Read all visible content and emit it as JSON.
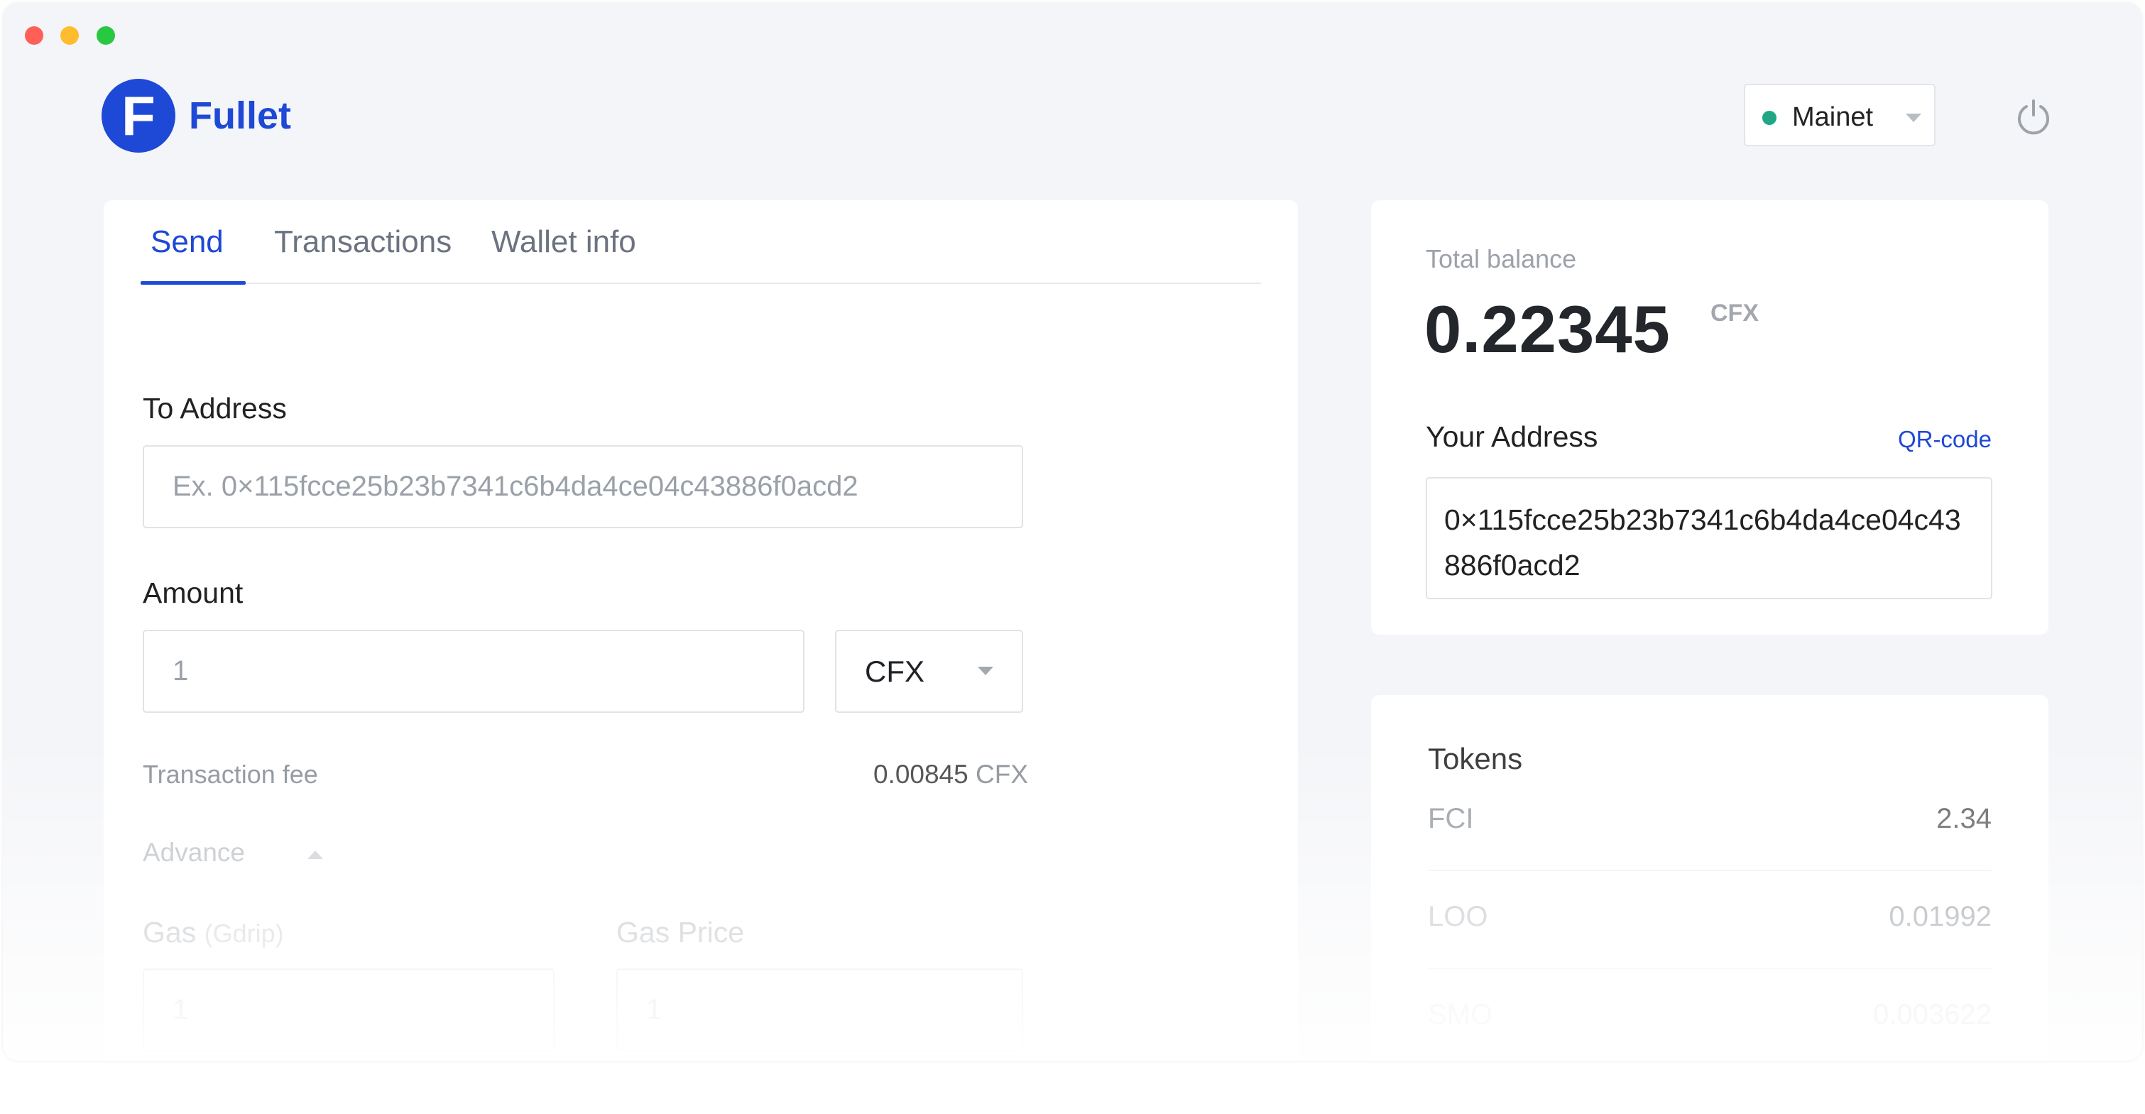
{
  "app": {
    "name": "Fullet",
    "logo_letter": "F"
  },
  "network": {
    "selected": "Mainet",
    "status_color": "#1fa785"
  },
  "tabs": [
    {
      "label": "Send",
      "active": true
    },
    {
      "label": "Transactions",
      "active": false
    },
    {
      "label": "Wallet info",
      "active": false
    }
  ],
  "send": {
    "to_address_label": "To Address",
    "to_address_placeholder": "Ex. 0×115fcce25b23b7341c6b4da4ce04c43886f0acd2",
    "amount_label": "Amount",
    "amount_placeholder": "1",
    "currency": "CFX",
    "fee_label": "Transaction fee",
    "fee_value": "0.00845",
    "fee_unit": "CFX",
    "advance_label": "Advance",
    "gas_label": "Gas",
    "gas_unit": "(Gdrip)",
    "gas_placeholder": "1",
    "gas_price_label": "Gas Price",
    "gas_price_placeholder": "1"
  },
  "balance": {
    "label": "Total balance",
    "value": "0.22345",
    "unit": "CFX",
    "address_label": "Your Address",
    "qr_link": "QR-code",
    "address": "0×115fcce25b23b7341c6b4da4ce04c43886f0acd2"
  },
  "tokens": {
    "title": "Tokens",
    "items": [
      {
        "name": "FCI",
        "value": "2.34"
      },
      {
        "name": "LOO",
        "value": "0.01992"
      },
      {
        "name": "SMO",
        "value": "0.003622"
      }
    ]
  },
  "colors": {
    "accent": "#1e48d6",
    "background": "#f4f5f8"
  }
}
